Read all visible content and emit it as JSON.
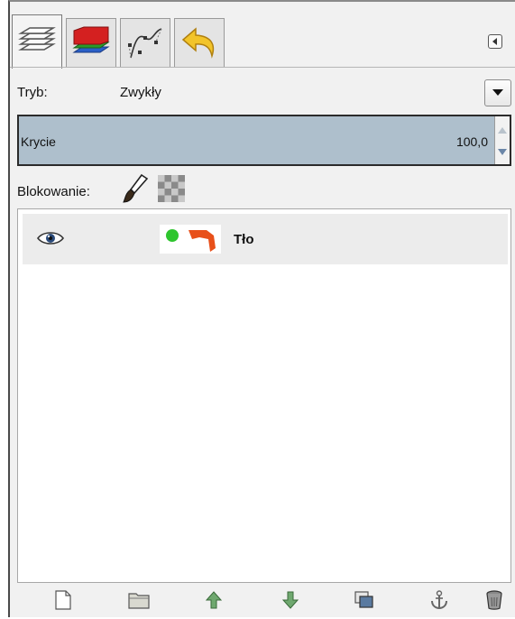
{
  "window": {
    "tabs": [
      {
        "name": "layers-tab",
        "icon": "layers-icon",
        "active": true
      },
      {
        "name": "channels-tab",
        "icon": "channels-icon",
        "active": false
      },
      {
        "name": "paths-tab",
        "icon": "paths-icon",
        "active": false
      },
      {
        "name": "undo-history-tab",
        "icon": "undo-icon",
        "active": false
      }
    ],
    "menu_icon": "tab-menu-icon"
  },
  "mode": {
    "label": "Tryb:",
    "value": "Zwykły"
  },
  "opacity": {
    "label": "Krycie",
    "value": "100,0"
  },
  "lock": {
    "label": "Blokowanie:",
    "icons": [
      "lock-pixels-icon",
      "lock-alpha-icon"
    ]
  },
  "layers": [
    {
      "name": "Tło",
      "visible": true
    }
  ],
  "toolbar": {
    "buttons": [
      "new-layer-icon",
      "new-layer-group-icon",
      "raise-layer-icon",
      "lower-layer-icon",
      "duplicate-layer-icon",
      "anchor-layer-icon",
      "delete-layer-icon"
    ]
  },
  "colors": {
    "opacity_fill": "#aebfcc",
    "selected_row": "#ececec",
    "channel_red": "#d42020",
    "channel_green": "#2a9a2a",
    "channel_blue": "#2a5fc8",
    "layer_green": "#2ec52e",
    "layer_orange": "#e8501a"
  }
}
